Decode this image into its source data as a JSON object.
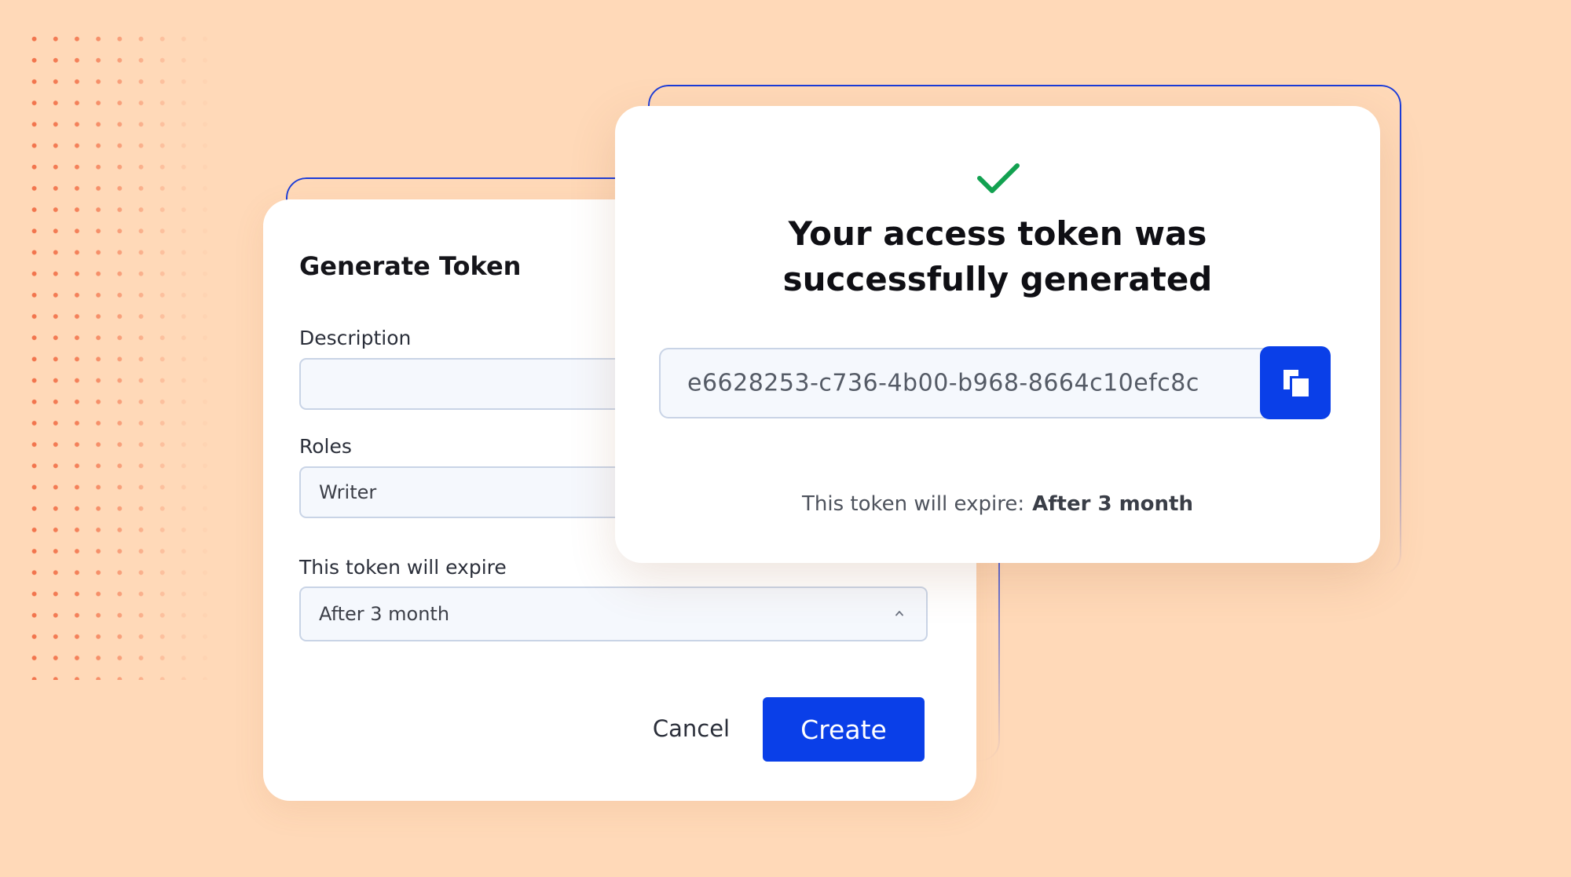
{
  "generate_dialog": {
    "title": "Generate Token",
    "description_label": "Description",
    "description_value": "",
    "roles_label": "Roles",
    "roles_value": "Writer",
    "expire_label": "This token will expire",
    "expire_value": "After 3 month",
    "cancel_label": "Cancel",
    "create_label": "Create"
  },
  "success_dialog": {
    "title_line1": "Your access token was",
    "title_line2": "successfully generated",
    "token": "e6628253-c736-4b00-b968-8664c10efc8c",
    "expire_label": "This token will expire:",
    "expire_value": "After 3 month"
  },
  "icons": {
    "success": "check-icon",
    "copy": "copy-icon",
    "dropdown": "chevron-up-icon"
  },
  "colors": {
    "background": "#FFD9B8",
    "accent": "#0A3FE8",
    "success": "#12A150",
    "dots": "#F2724A"
  }
}
